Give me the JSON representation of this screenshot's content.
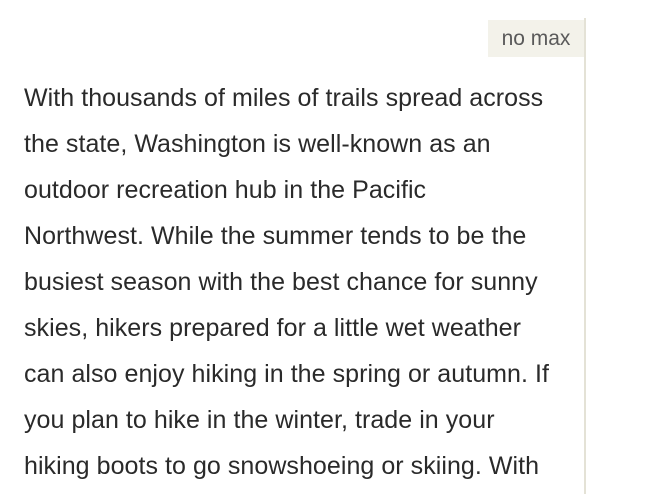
{
  "max_label": "no max",
  "paragraph_lines": [
    "With thousands of miles of trails spread across",
    "the state, Washington is well-known as an",
    "outdoor recreation hub in the Pacific",
    "Northwest. While the summer tends to be the",
    "busiest season with the best chance for sunny",
    "skies, hikers prepared for a little wet weather",
    "can also enjoy hiking in the spring or autumn. If",
    "you plan to hike in the winter, trade in your",
    "hiking boots to go snowshoeing or skiing. With"
  ]
}
